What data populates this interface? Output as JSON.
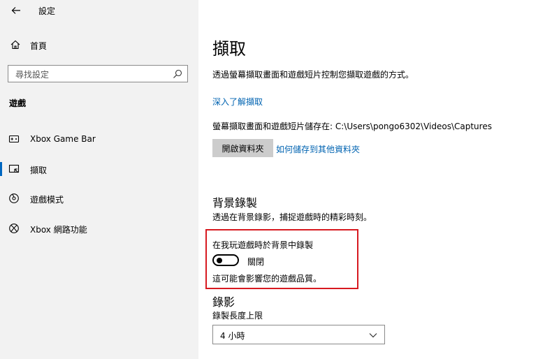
{
  "app": {
    "title": "設定"
  },
  "sidebar": {
    "home_label": "首頁",
    "search_placeholder": "尋找設定",
    "section_label": "遊戲",
    "items": [
      {
        "label": "Xbox Game Bar",
        "icon": "xbox-game-bar-icon",
        "selected": false
      },
      {
        "label": "擷取",
        "icon": "capture-icon",
        "selected": true
      },
      {
        "label": "遊戲模式",
        "icon": "game-mode-icon",
        "selected": false
      },
      {
        "label": "Xbox 網路功能",
        "icon": "xbox-icon",
        "selected": false
      }
    ]
  },
  "main": {
    "title": "擷取",
    "description": "透過螢幕擷取畫面和遊戲短片控制您擷取遊戲的方式。",
    "learn_more": "深入了解擷取",
    "save_path": "螢幕擷取畫面和遊戲短片儲存在: C:\\Users\\pongo6302\\Videos\\Captures",
    "open_folder_button": "開啟資料夾",
    "other_folder_link": "如何儲存到其他資料夾",
    "background": {
      "heading": "背景錄製",
      "description": "透過在背景錄影，捕捉遊戲時的精彩時刻。",
      "toggle_label": "在我玩遊戲時於背景中錄製",
      "toggle_state": "關閉",
      "toggle_on": false,
      "note": "這可能會影響您的遊戲品質。"
    },
    "recording": {
      "heading": "錄影",
      "length_label": "錄製長度上限",
      "length_value": "4 小時"
    }
  },
  "colors": {
    "accent": "#0067c0",
    "link": "#0063b1",
    "highlight": "#d71920"
  }
}
